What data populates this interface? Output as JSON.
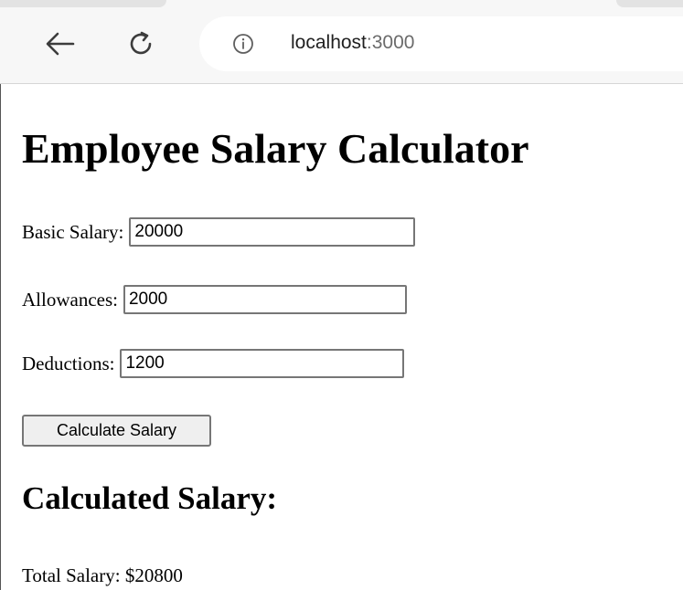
{
  "browser": {
    "url_host": "localhost",
    "url_port": ":3000"
  },
  "page": {
    "title": "Employee Salary Calculator",
    "fields": [
      {
        "label": "Basic Salary:",
        "value": "20000"
      },
      {
        "label": "Allowances:",
        "value": "2000"
      },
      {
        "label": "Deductions:",
        "value": "1200"
      }
    ],
    "button_label": "Calculate Salary",
    "result_heading": "Calculated Salary:",
    "total_line": "Total Salary: $20800"
  },
  "colors": {
    "chrome_bg": "#f7f7f7",
    "button_bg": "#efefef",
    "text": "#000000"
  },
  "icons": {
    "back": "back-arrow-icon",
    "reload": "reload-icon",
    "info": "info-icon"
  }
}
